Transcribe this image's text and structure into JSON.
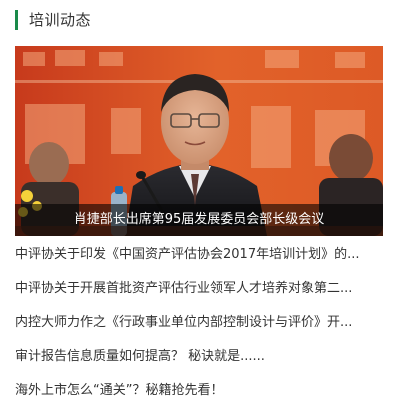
{
  "section": {
    "title": "培训动态",
    "accent_color": "#1a8a4a"
  },
  "featured": {
    "caption": "肖捷部长出席第95届发展委员会部长级会议"
  },
  "news": [
    {
      "title": "中评协关于印发《中国资产评估协会2017年培训计划》的..."
    },
    {
      "title": "中评协关于开展首批资产评估行业领军人才培养对象第二..."
    },
    {
      "title": "内控大师力作之《行政事业单位内部控制设计与评价》开..."
    },
    {
      "title": "审计报告信息质量如何提高？ 秘诀就是......"
    },
    {
      "title": "海外上市怎么“通关”？秘籍抢先看！"
    }
  ]
}
